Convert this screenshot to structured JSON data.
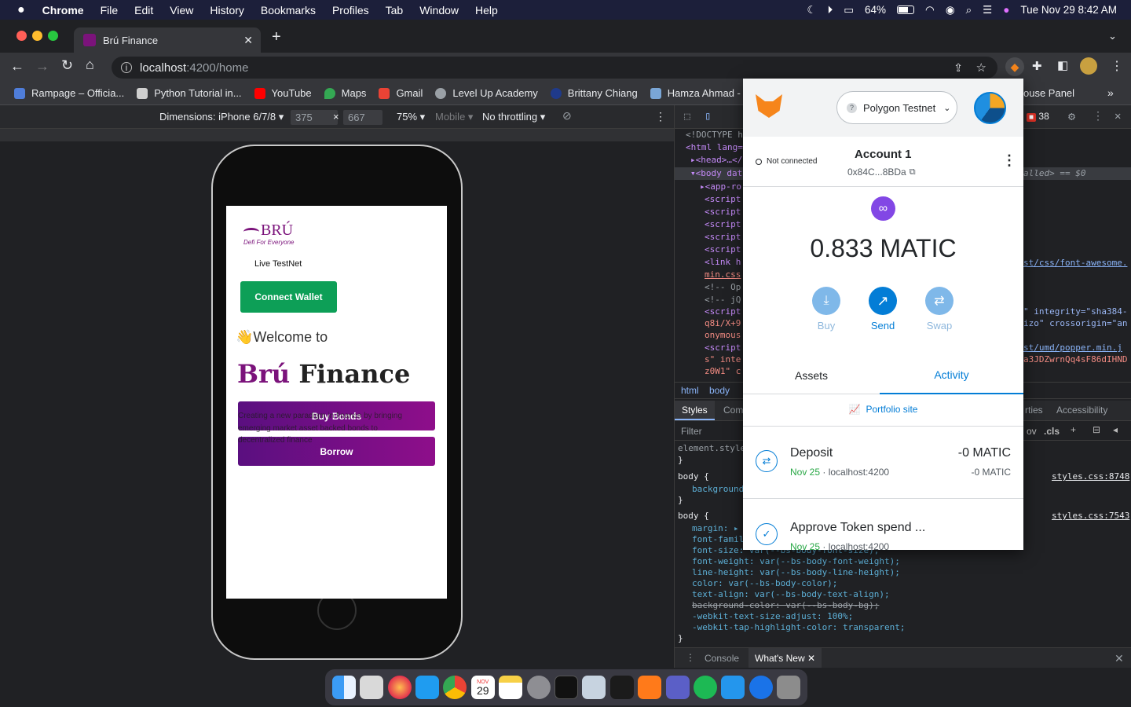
{
  "menubar": {
    "app": "Chrome",
    "items": [
      "File",
      "Edit",
      "View",
      "History",
      "Bookmarks",
      "Profiles",
      "Tab",
      "Window",
      "Help"
    ],
    "battery": "64%",
    "clock": "Tue Nov 29  8:42 AM"
  },
  "browser": {
    "tab_title": "Brú Finance",
    "url_host": "localhost",
    "url_path": ":4200/home",
    "bookmarks": [
      {
        "label": "Rampage – Officia...",
        "color": "#4f7dd9"
      },
      {
        "label": "Python Tutorial in...",
        "color": "#cfcfcf"
      },
      {
        "label": "YouTube",
        "color": "#ff0000"
      },
      {
        "label": "Maps",
        "color": "#34a853"
      },
      {
        "label": "Gmail",
        "color": "#ea4335"
      },
      {
        "label": "Level Up Academy",
        "color": "#9aa0a6"
      },
      {
        "label": "Brittany Chiang",
        "color": "#1f3a8a"
      },
      {
        "label": "Hamza Ahmad - F",
        "color": "#7aa6d6"
      }
    ],
    "bookmark_overflow": "ouse Panel"
  },
  "device_toolbar": {
    "dimensions_label": "Dimensions: iPhone 6/7/8 ▾",
    "width": "375",
    "times": "×",
    "height": "667",
    "zoom": "75% ▾",
    "mobile": "Mobile ▾",
    "throttle": "No throttling ▾"
  },
  "app": {
    "logo_text": "BRÚ",
    "logo_tagline": "Defi For Everyone",
    "network_label": "Live TestNet",
    "connect_button": "Connect Wallet",
    "welcome": "👋Welcome to",
    "brand_accent": "Brú",
    "brand_rest": " Finance",
    "description": "Creating a new paradigm in finance by bringing emerging market asset backed bonds to decentralized finance",
    "buy_bonds": "Buy Bonds",
    "borrow": "Borrow",
    "accent_color": "#7b137b",
    "connect_color": "#0d9f57"
  },
  "devtools": {
    "elements_lines": [
      "<!DOCTYPE h",
      "<html lang=",
      "▸<head>…</",
      "▾<body dat",
      "▸<app-ro",
      "<script",
      "<script",
      "<script",
      "<script",
      "<script",
      "<link h",
      "min.css",
      "<!-- Op",
      "<!-- jQ",
      "<script",
      "q8i/X+9",
      "onymous",
      "<script",
      "s\" inte",
      "z0W1\" c"
    ],
    "right_snippets": {
      "called": "alled> == $0",
      "fa": "st/css/font-awesome.",
      "integrity": "\" integrity=\"sha384-",
      "crossorigin": "izo\" crossorigin=\"an",
      "popper": "st/umd/popper.min.j",
      "hash": "a3JDZwrnQq4sF86dIHND"
    },
    "breadcrumb": [
      "html",
      "body"
    ],
    "tabs_left": [
      "Styles",
      "Com"
    ],
    "tabs_right": [
      "rties",
      "Accessibility"
    ],
    "filter_placeholder": "Filter",
    "hov": "ov",
    "cls": ".cls",
    "issues": "38",
    "styles": {
      "element_style": "element.style",
      "rule1_selector": "body {",
      "rule1_prop": "background",
      "rule1_src": "styles.css:8748",
      "rule2_selector": "body {",
      "rule2_src": "styles.css:7543",
      "decls": [
        "margin: ▸ 0",
        "font-famil",
        "font-size: var(--bs-body-font-size);",
        "font-weight: var(--bs-body-font-weight);",
        "line-height: var(--bs-body-line-height);",
        "color: var(--bs-body-color);",
        "text-align: var(--bs-body-text-align);",
        "background-color: var(--bs-body-bg);",
        "-webkit-text-size-adjust: 100%;",
        "-webkit-tap-highlight-color: transparent;"
      ]
    },
    "drawer_tabs": [
      "Console",
      "What's New"
    ]
  },
  "metamask": {
    "network": "Polygon Testnet",
    "connection": "Not connected",
    "account_name": "Account 1",
    "address": "0x84C...8BDa",
    "balance": "0.833 MATIC",
    "actions": [
      "Buy",
      "Send",
      "Swap"
    ],
    "tabs": [
      "Assets",
      "Activity"
    ],
    "portfolio": "Portfolio site",
    "activity": [
      {
        "title": "Deposit",
        "date": "Nov 25",
        "origin": " · localhost:4200",
        "amount": "-0 MATIC",
        "sub_amount": "-0 MATIC"
      },
      {
        "title": "Approve Token spend ...",
        "date": "Nov 25",
        "origin": " · localhost:4200"
      }
    ],
    "accent": "#037dd6",
    "polygon_color": "#8247e5"
  },
  "dock": {
    "calendar_month": "NOV",
    "calendar_day": "29"
  }
}
